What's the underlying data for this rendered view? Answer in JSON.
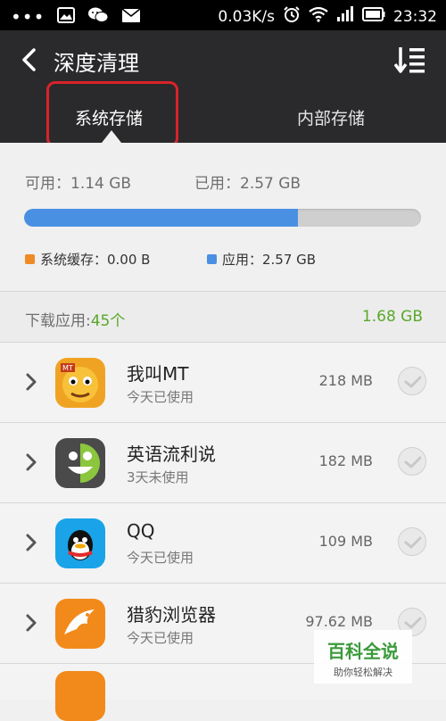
{
  "status_bar": {
    "dots": "•••",
    "net_speed": "0.03K/s",
    "time": "23:32",
    "icons": [
      "image-icon",
      "wechat-icon",
      "mail-icon",
      "alarm-icon",
      "wifi-icon",
      "signal-icon",
      "battery-icon"
    ]
  },
  "header": {
    "title": "深度清理",
    "tabs": [
      {
        "label": "系统存储",
        "active": true
      },
      {
        "label": "内部存储",
        "active": false
      }
    ]
  },
  "storage": {
    "available": "可用：1.14 GB",
    "used": "已用：2.57 GB",
    "used_fraction": 0.69,
    "legend": [
      {
        "label": "系统缓存：0.00 B",
        "color": "#f08a24"
      },
      {
        "label": "应用：2.57 GB",
        "color": "#4a90e2"
      }
    ]
  },
  "downloads": {
    "label": "下载应用:",
    "count": "45个",
    "total": "1.68 GB"
  },
  "apps": [
    {
      "name": "我叫MT",
      "sub": "今天已使用",
      "size": "218 MB",
      "icon": "mt-game-icon"
    },
    {
      "name": "英语流利说",
      "sub": "3天未使用",
      "size": "182 MB",
      "icon": "english-app-icon"
    },
    {
      "name": "QQ",
      "sub": "今天已使用",
      "size": "109 MB",
      "icon": "qq-icon"
    },
    {
      "name": "猎豹浏览器",
      "sub": "今天已使用",
      "size": "97.62 MB",
      "icon": "cheetah-browser-icon"
    }
  ],
  "watermark": {
    "main": "百科全说",
    "sub": "助你轻松解决"
  },
  "colors": {
    "accent_green": "#5aa82a",
    "bar_blue": "#4a90e2",
    "highlight_red": "#d9232a"
  }
}
